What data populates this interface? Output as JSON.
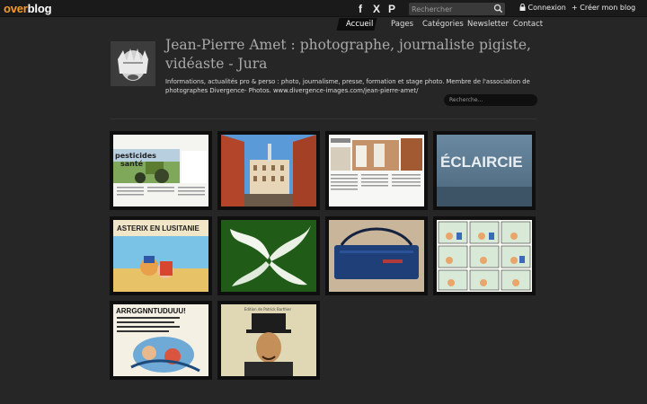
{
  "topbar": {
    "logo_part1": "over",
    "logo_part2": "blog",
    "social": [
      {
        "icon": "facebook-icon",
        "glyph": "f"
      },
      {
        "icon": "x-icon",
        "glyph": "X"
      },
      {
        "icon": "pinterest-icon",
        "glyph": "P"
      }
    ],
    "search_placeholder": "Rechercher",
    "login_label": "Connexion",
    "create_label": "Créer mon blog"
  },
  "nav": {
    "items": [
      "Accueil",
      "Pages",
      "Catégories",
      "Newsletter",
      "Contact"
    ],
    "active": "Accueil"
  },
  "blog": {
    "title": "Jean-Pierre Amet : photographe, journaliste pigiste, vidéaste - Jura",
    "description": "Informations, actualités pro & perso : photo, journalisme, presse, formation et stage photo. Membre de l'association de photographes Divergence- Photos. www.divergence-images.com/jean-pierre-amet/",
    "search_placeholder": "Recherche..."
  },
  "thumbnails": {
    "eclaircie_text": "ÉCLAIRCIE",
    "pesticides_text": "pesticides",
    "sante_text": "santé",
    "asterix_text": "ASTERIX EN LUSITANIE",
    "comic_text": "ARRGGNNTUDUUU!",
    "book_text": "Edition de Patrick Barthier"
  },
  "colors": {
    "background": "#262626",
    "topbar": "#1a1a1a",
    "logo_accent": "#f39c2a",
    "title": "#a9a9a9"
  }
}
